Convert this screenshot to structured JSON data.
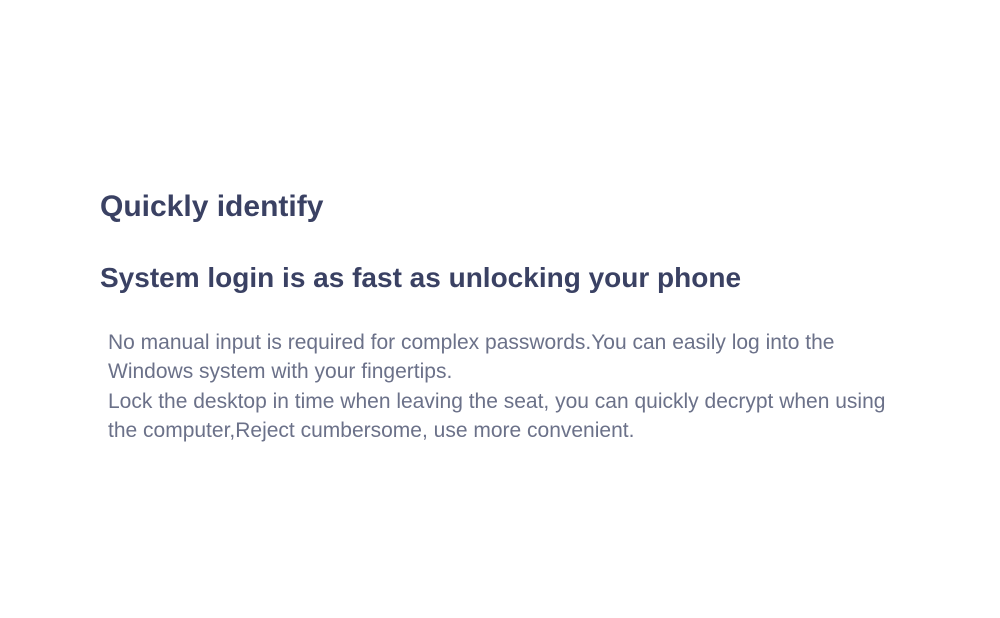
{
  "content": {
    "title": "Quickly identify",
    "subtitle": "System login is as fast as unlocking your phone",
    "body": "No manual input is required for complex passwords.You can easily log into the Windows system with your fingertips.\nLock the desktop in time when leaving the seat, you can quickly decrypt when using the computer,Reject cumbersome, use more convenient."
  }
}
